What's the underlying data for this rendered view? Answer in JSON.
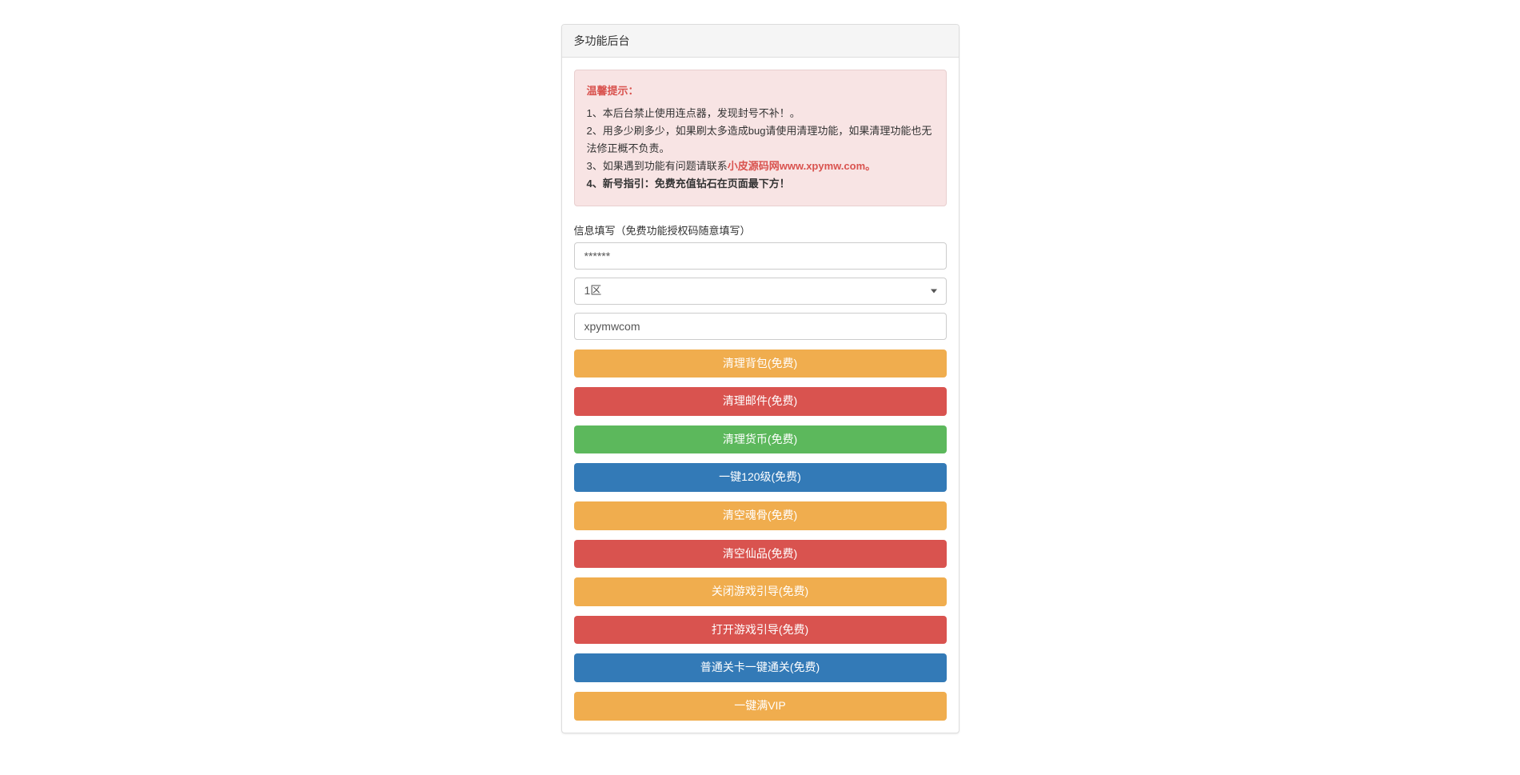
{
  "panel": {
    "title": "多功能后台"
  },
  "notice": {
    "title": "温馨提示：",
    "line1": "1、本后台禁止使用连点器，发现封号不补！。",
    "line2": "2、用多少刷多少，如果刷太多造成bug请使用清理功能，如果清理功能也无法修正概不负责。",
    "line3_prefix": "3、如果遇到功能有问题请联系",
    "line3_highlight": "小皮源码网www.xpymw.com。",
    "line4": "4、新号指引：免费充值钻石在页面最下方！"
  },
  "form": {
    "section_label": "信息填写（免费功能授权码随意填写）",
    "auth_code_value": "******",
    "zone_selected": "1区",
    "username_value": "xpymwcom"
  },
  "buttons": {
    "b1": "清理背包(免费)",
    "b2": "清理邮件(免费)",
    "b3": "清理货币(免费)",
    "b4": "一键120级(免费)",
    "b5": "清空魂骨(免费)",
    "b6": "清空仙品(免费)",
    "b7": "关闭游戏引导(免费)",
    "b8": "打开游戏引导(免费)",
    "b9": "普通关卡一键通关(免费)",
    "b10": "一键满VIP"
  }
}
